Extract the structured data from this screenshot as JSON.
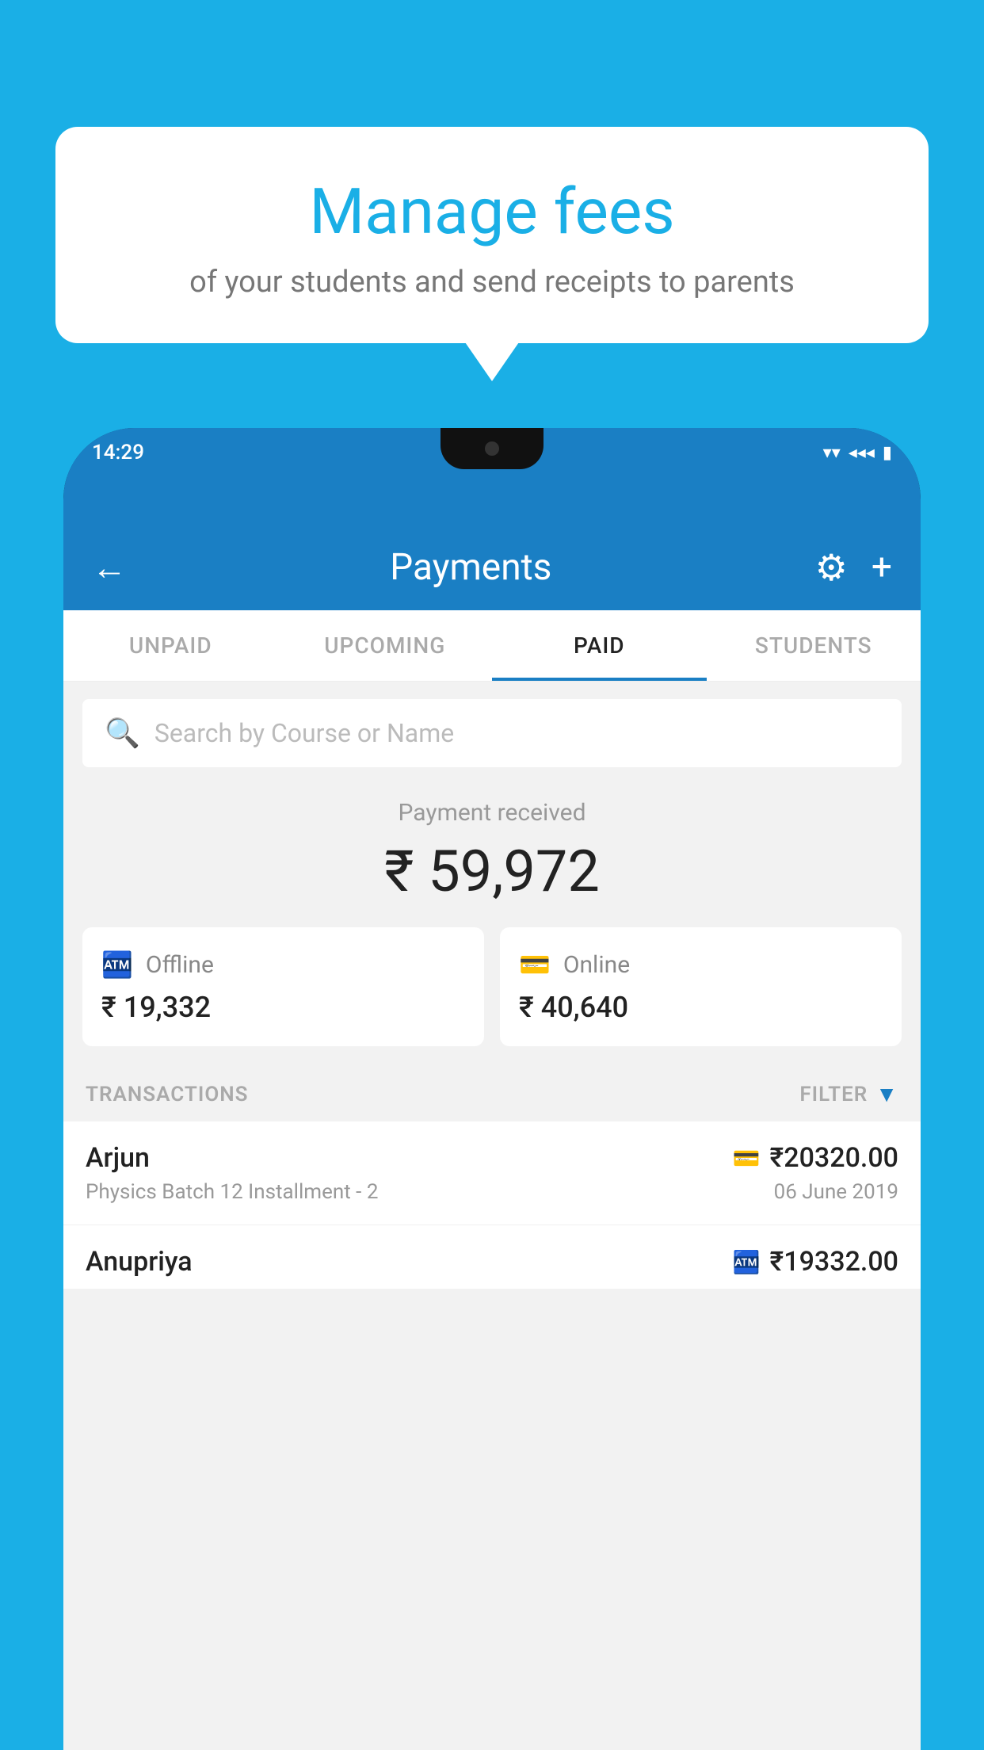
{
  "background_color": "#1AAFE6",
  "speech_bubble": {
    "title": "Manage fees",
    "subtitle": "of your students and send receipts to parents"
  },
  "status_bar": {
    "time": "14:29",
    "icons": [
      "wifi",
      "signal",
      "battery"
    ]
  },
  "app_bar": {
    "title": "Payments",
    "back_label": "←",
    "settings_label": "⚙",
    "add_label": "+"
  },
  "tabs": [
    {
      "label": "UNPAID",
      "active": false
    },
    {
      "label": "UPCOMING",
      "active": false
    },
    {
      "label": "PAID",
      "active": true
    },
    {
      "label": "STUDENTS",
      "active": false
    }
  ],
  "search": {
    "placeholder": "Search by Course or Name"
  },
  "payment_summary": {
    "label": "Payment received",
    "total": "₹ 59,972",
    "offline_label": "Offline",
    "offline_amount": "₹ 19,332",
    "online_label": "Online",
    "online_amount": "₹ 40,640"
  },
  "transactions": {
    "header_label": "TRANSACTIONS",
    "filter_label": "FILTER",
    "rows": [
      {
        "name": "Arjun",
        "amount": "₹20320.00",
        "course": "Physics Batch 12 Installment - 2",
        "date": "06 June 2019",
        "payment_type": "card"
      },
      {
        "name": "Anupriya",
        "amount": "₹19332.00",
        "payment_type": "cash",
        "partial": true
      }
    ]
  }
}
